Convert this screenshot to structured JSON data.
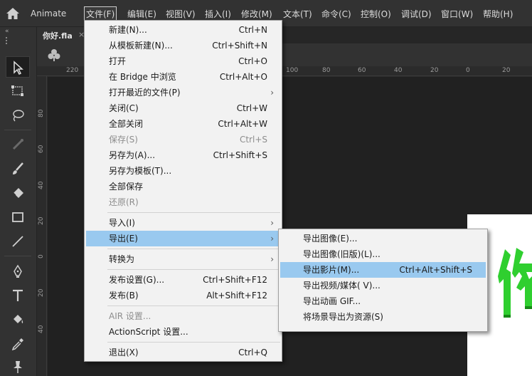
{
  "app": {
    "name": "Animate"
  },
  "menubar": {
    "items": [
      "文件(F)",
      "编辑(E)",
      "视图(V)",
      "插入(I)",
      "修改(M)",
      "文本(T)",
      "命令(C)",
      "控制(O)",
      "调试(D)",
      "窗口(W)",
      "帮助(H)"
    ],
    "active": "文件(F)"
  },
  "document_tab": {
    "title": "你好.fla",
    "close": "×"
  },
  "rulers": {
    "horizontal": [
      "220",
      "100",
      "80",
      "60",
      "40",
      "20",
      "0",
      "20"
    ],
    "vertical": [
      "80",
      "60",
      "40",
      "20",
      "0",
      "20",
      "40"
    ]
  },
  "file_menu": {
    "items": [
      {
        "label": "新建(N)...",
        "shortcut": "Ctrl+N"
      },
      {
        "label": "从模板新建(N)...",
        "shortcut": "Ctrl+Shift+N"
      },
      {
        "label": "打开",
        "shortcut": "Ctrl+O"
      },
      {
        "label": "在 Bridge 中浏览",
        "shortcut": "Ctrl+Alt+O"
      },
      {
        "label": "打开最近的文件(P)",
        "shortcut": "",
        "submenu": "›"
      },
      {
        "label": "关闭(C)",
        "shortcut": "Ctrl+W"
      },
      {
        "label": "全部关闭",
        "shortcut": "Ctrl+Alt+W"
      },
      {
        "label": "保存(S)",
        "shortcut": "Ctrl+S",
        "disabled": true
      },
      {
        "label": "另存为(A)...",
        "shortcut": "Ctrl+Shift+S"
      },
      {
        "label": "另存为模板(T)...",
        "shortcut": ""
      },
      {
        "label": "全部保存",
        "shortcut": ""
      },
      {
        "label": "还原(R)",
        "shortcut": "",
        "disabled": true
      },
      {
        "label": "导入(I)",
        "shortcut": "",
        "submenu": "›"
      },
      {
        "label": "导出(E)",
        "shortcut": "",
        "submenu": "›",
        "highlighted": true
      },
      {
        "label": "转换为",
        "shortcut": "",
        "submenu": "›"
      },
      {
        "label": "发布设置(G)...",
        "shortcut": "Ctrl+Shift+F12"
      },
      {
        "label": "发布(B)",
        "shortcut": "Alt+Shift+F12"
      },
      {
        "label": "AIR 设置...",
        "shortcut": "",
        "disabled": true
      },
      {
        "label": "ActionScript 设置...",
        "shortcut": ""
      },
      {
        "label": "退出(X)",
        "shortcut": "Ctrl+Q"
      }
    ]
  },
  "export_menu": {
    "items": [
      {
        "label": "导出图像(E)...",
        "shortcut": ""
      },
      {
        "label": "导出图像(旧版)(L)...",
        "shortcut": ""
      },
      {
        "label": "导出影片(M)...",
        "shortcut": "Ctrl+Alt+Shift+S",
        "highlighted": true
      },
      {
        "label": "导出视频/媒体( V)...",
        "shortcut": ""
      },
      {
        "label": "导出动画 GIF...",
        "shortcut": ""
      },
      {
        "label": "将场景导出为资源(S)",
        "shortcut": ""
      }
    ]
  },
  "tools": [
    "selection-tool",
    "free-transform-tool",
    "lasso-tool",
    "bone-tool",
    "brush-tool",
    "eraser-tool",
    "rectangle-tool",
    "line-tool",
    "pen-tool",
    "text-tool",
    "paint-bucket-tool",
    "eyedropper-tool",
    "pin-tool"
  ],
  "colors": {
    "highlight": "#99c9ef",
    "menu_bg": "#f2f2f2",
    "panel": "#323232",
    "stage": "#212121",
    "glyph_green": "#2ecc2e"
  }
}
